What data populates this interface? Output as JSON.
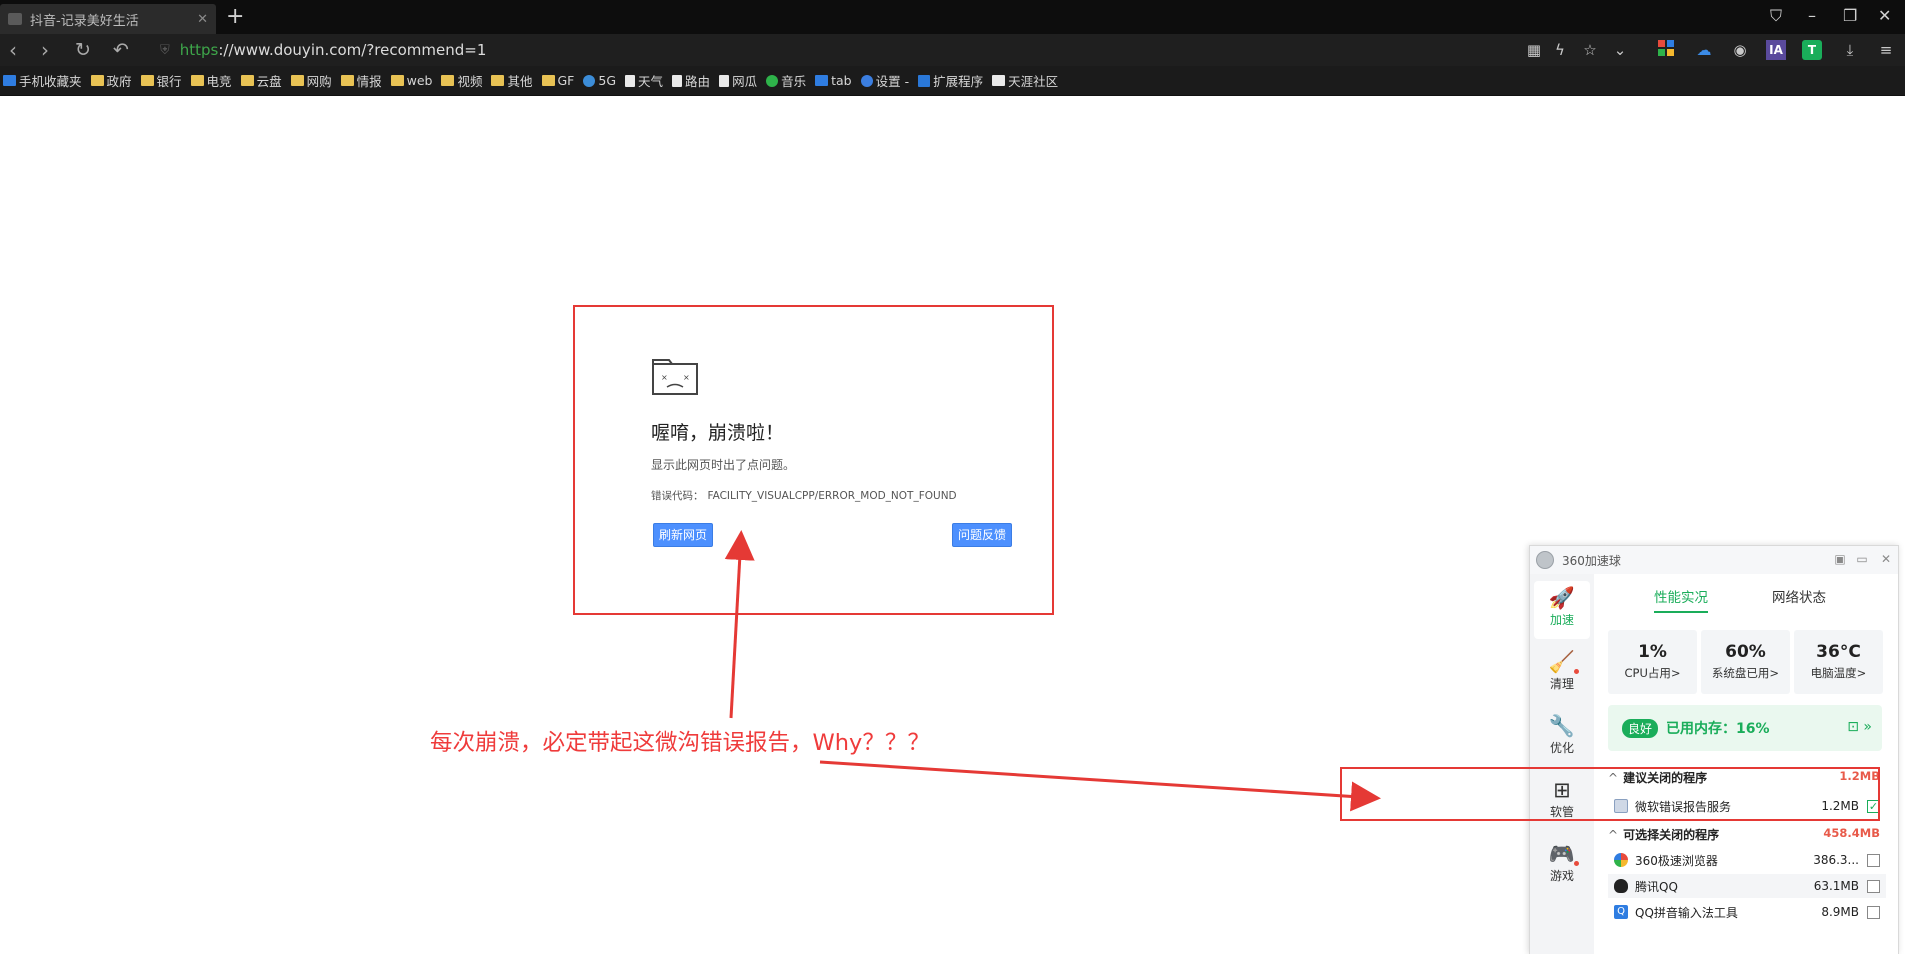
{
  "browser": {
    "tab_title": "抖音-记录美好生活",
    "tab_close": "✕",
    "new_tab": "+",
    "url_scheme": "https",
    "url_rest": "://www.douyin.com/?recommend=1",
    "bookmarks": [
      {
        "label": "手机收藏夹",
        "icon": "blue"
      },
      {
        "label": "政府",
        "icon": "folder"
      },
      {
        "label": "银行",
        "icon": "folder"
      },
      {
        "label": "电竞",
        "icon": "folder"
      },
      {
        "label": "云盘",
        "icon": "folder"
      },
      {
        "label": "网购",
        "icon": "folder"
      },
      {
        "label": "情报",
        "icon": "folder"
      },
      {
        "label": "web",
        "icon": "folder"
      },
      {
        "label": "视频",
        "icon": "folder"
      },
      {
        "label": "其他",
        "icon": "folder"
      },
      {
        "label": "GF",
        "icon": "folder"
      },
      {
        "label": "5G",
        "icon": "globe"
      },
      {
        "label": "天气",
        "icon": "doc"
      },
      {
        "label": "路由",
        "icon": "doc"
      },
      {
        "label": "网瓜",
        "icon": "doc"
      },
      {
        "label": "音乐",
        "icon": "green"
      },
      {
        "label": "tab",
        "icon": "blue"
      },
      {
        "label": "设置 -",
        "icon": "gear"
      },
      {
        "label": "扩展程序",
        "icon": "puzzle"
      },
      {
        "label": "天涯社区",
        "icon": "w"
      }
    ]
  },
  "crash": {
    "title": "喔唷，崩溃啦！",
    "desc": "显示此网页时出了点问题。",
    "code_label": "错误代码：",
    "code": "FACILITY_VISUALCPP/ERROR_MOD_NOT_FOUND",
    "reload_button": "刷新网页",
    "feedback_button": "问题反馈"
  },
  "annotation": "每次崩溃，必定带起这微沟错误报告，Why？？？",
  "annotation_color": "#ef3b3b",
  "panel": {
    "title": "360加速球",
    "side": [
      {
        "label": "加速",
        "icon": "rocket-icon",
        "glyph": "🚀"
      },
      {
        "label": "清理",
        "icon": "broom-icon",
        "glyph": "🧹"
      },
      {
        "label": "优化",
        "icon": "wrench-icon",
        "glyph": "🔧"
      },
      {
        "label": "软管",
        "icon": "apps-icon",
        "glyph": "⊞"
      },
      {
        "label": "游戏",
        "icon": "gamepad-icon",
        "glyph": "🎮"
      }
    ],
    "tabs": {
      "perf": "性能实况",
      "net": "网络状态"
    },
    "stats": [
      {
        "value": "1%",
        "label": "CPU占用>"
      },
      {
        "value": "60%",
        "label": "系统盘已用>"
      },
      {
        "value": "36°C",
        "label": "电脑温度>"
      }
    ],
    "mem_badge": "良好",
    "mem_text": "已用内存：16%",
    "suggest_title": "建议关闭的程序",
    "suggest_size": "1.2MB",
    "suggest_rows": [
      {
        "name": "微软错误报告服务",
        "size": "1.2MB",
        "checked": true
      }
    ],
    "optional_title": "可选择关闭的程序",
    "optional_size": "458.4MB",
    "optional_rows": [
      {
        "name": "360极速浏览器",
        "size": "386.3...",
        "checked": false
      },
      {
        "name": "腾讯QQ",
        "size": "63.1MB",
        "checked": false
      },
      {
        "name": "QQ拼音输入法工具",
        "size": "8.9MB",
        "checked": false
      }
    ]
  },
  "colors": {
    "accent_green": "#1aad5a",
    "highlight_red": "#e53935",
    "link_blue": "#4d90fe"
  }
}
